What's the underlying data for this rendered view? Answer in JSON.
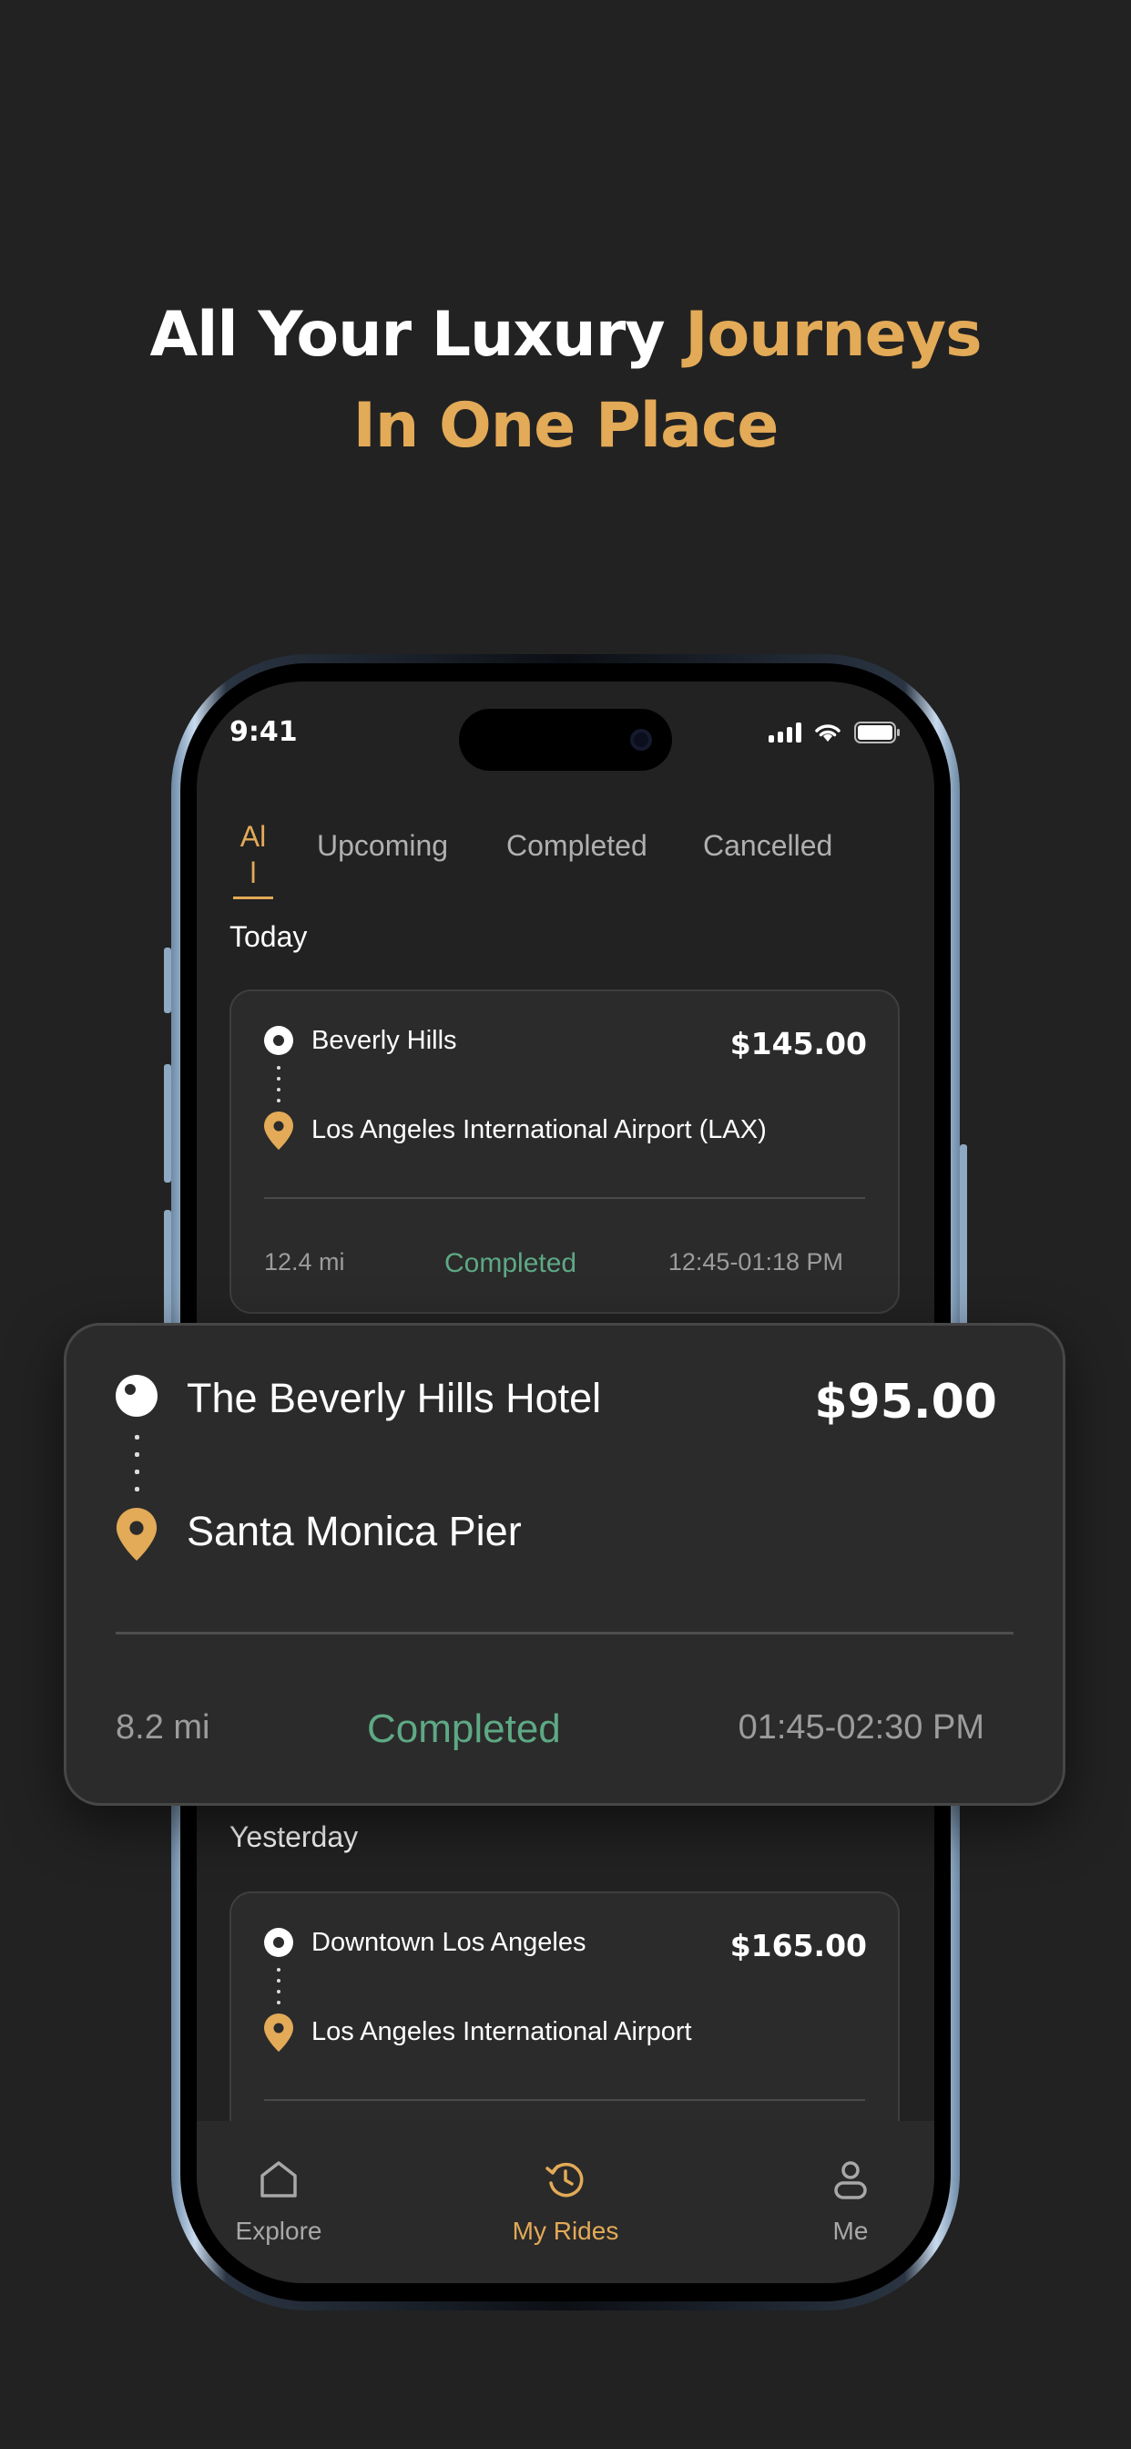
{
  "headline": {
    "line1_white": "All Your Luxury ",
    "line1_gold": "Journeys",
    "line2_gold": "In One Place"
  },
  "status_bar": {
    "time": "9:41"
  },
  "tabs": [
    {
      "label": "Al\nl",
      "active": true
    },
    {
      "label": "Upcoming",
      "active": false
    },
    {
      "label": "Completed",
      "active": false
    },
    {
      "label": "Cancelled",
      "active": false
    }
  ],
  "sections": {
    "today": "Today",
    "yesterday": "Yesterday"
  },
  "rides": [
    {
      "from": "Beverly Hills",
      "to": "Los Angeles International Airport (LAX)",
      "price": "$145.00",
      "distance": "12.4 mi",
      "status": "Completed",
      "time": "12:45-01:18 PM"
    },
    {
      "from": "The Beverly Hills Hotel",
      "to": "Santa Monica Pier",
      "price": "$95.00",
      "distance": "8.2 mi",
      "status": "Completed",
      "time": "01:45-02:30 PM"
    },
    {
      "from": "Downtown Los Angeles",
      "to": "Los Angeles International Airport",
      "price": "$165.00"
    }
  ],
  "bottom_nav": [
    {
      "label": "Explore",
      "icon": "home-icon",
      "active": false
    },
    {
      "label": "My Rides",
      "icon": "history-icon",
      "active": true
    },
    {
      "label": "Me",
      "icon": "person-icon",
      "active": false
    }
  ],
  "colors": {
    "background": "#222222",
    "accent": "#e3aa57",
    "completed": "#5ea985",
    "card": "#2b2b2b"
  }
}
